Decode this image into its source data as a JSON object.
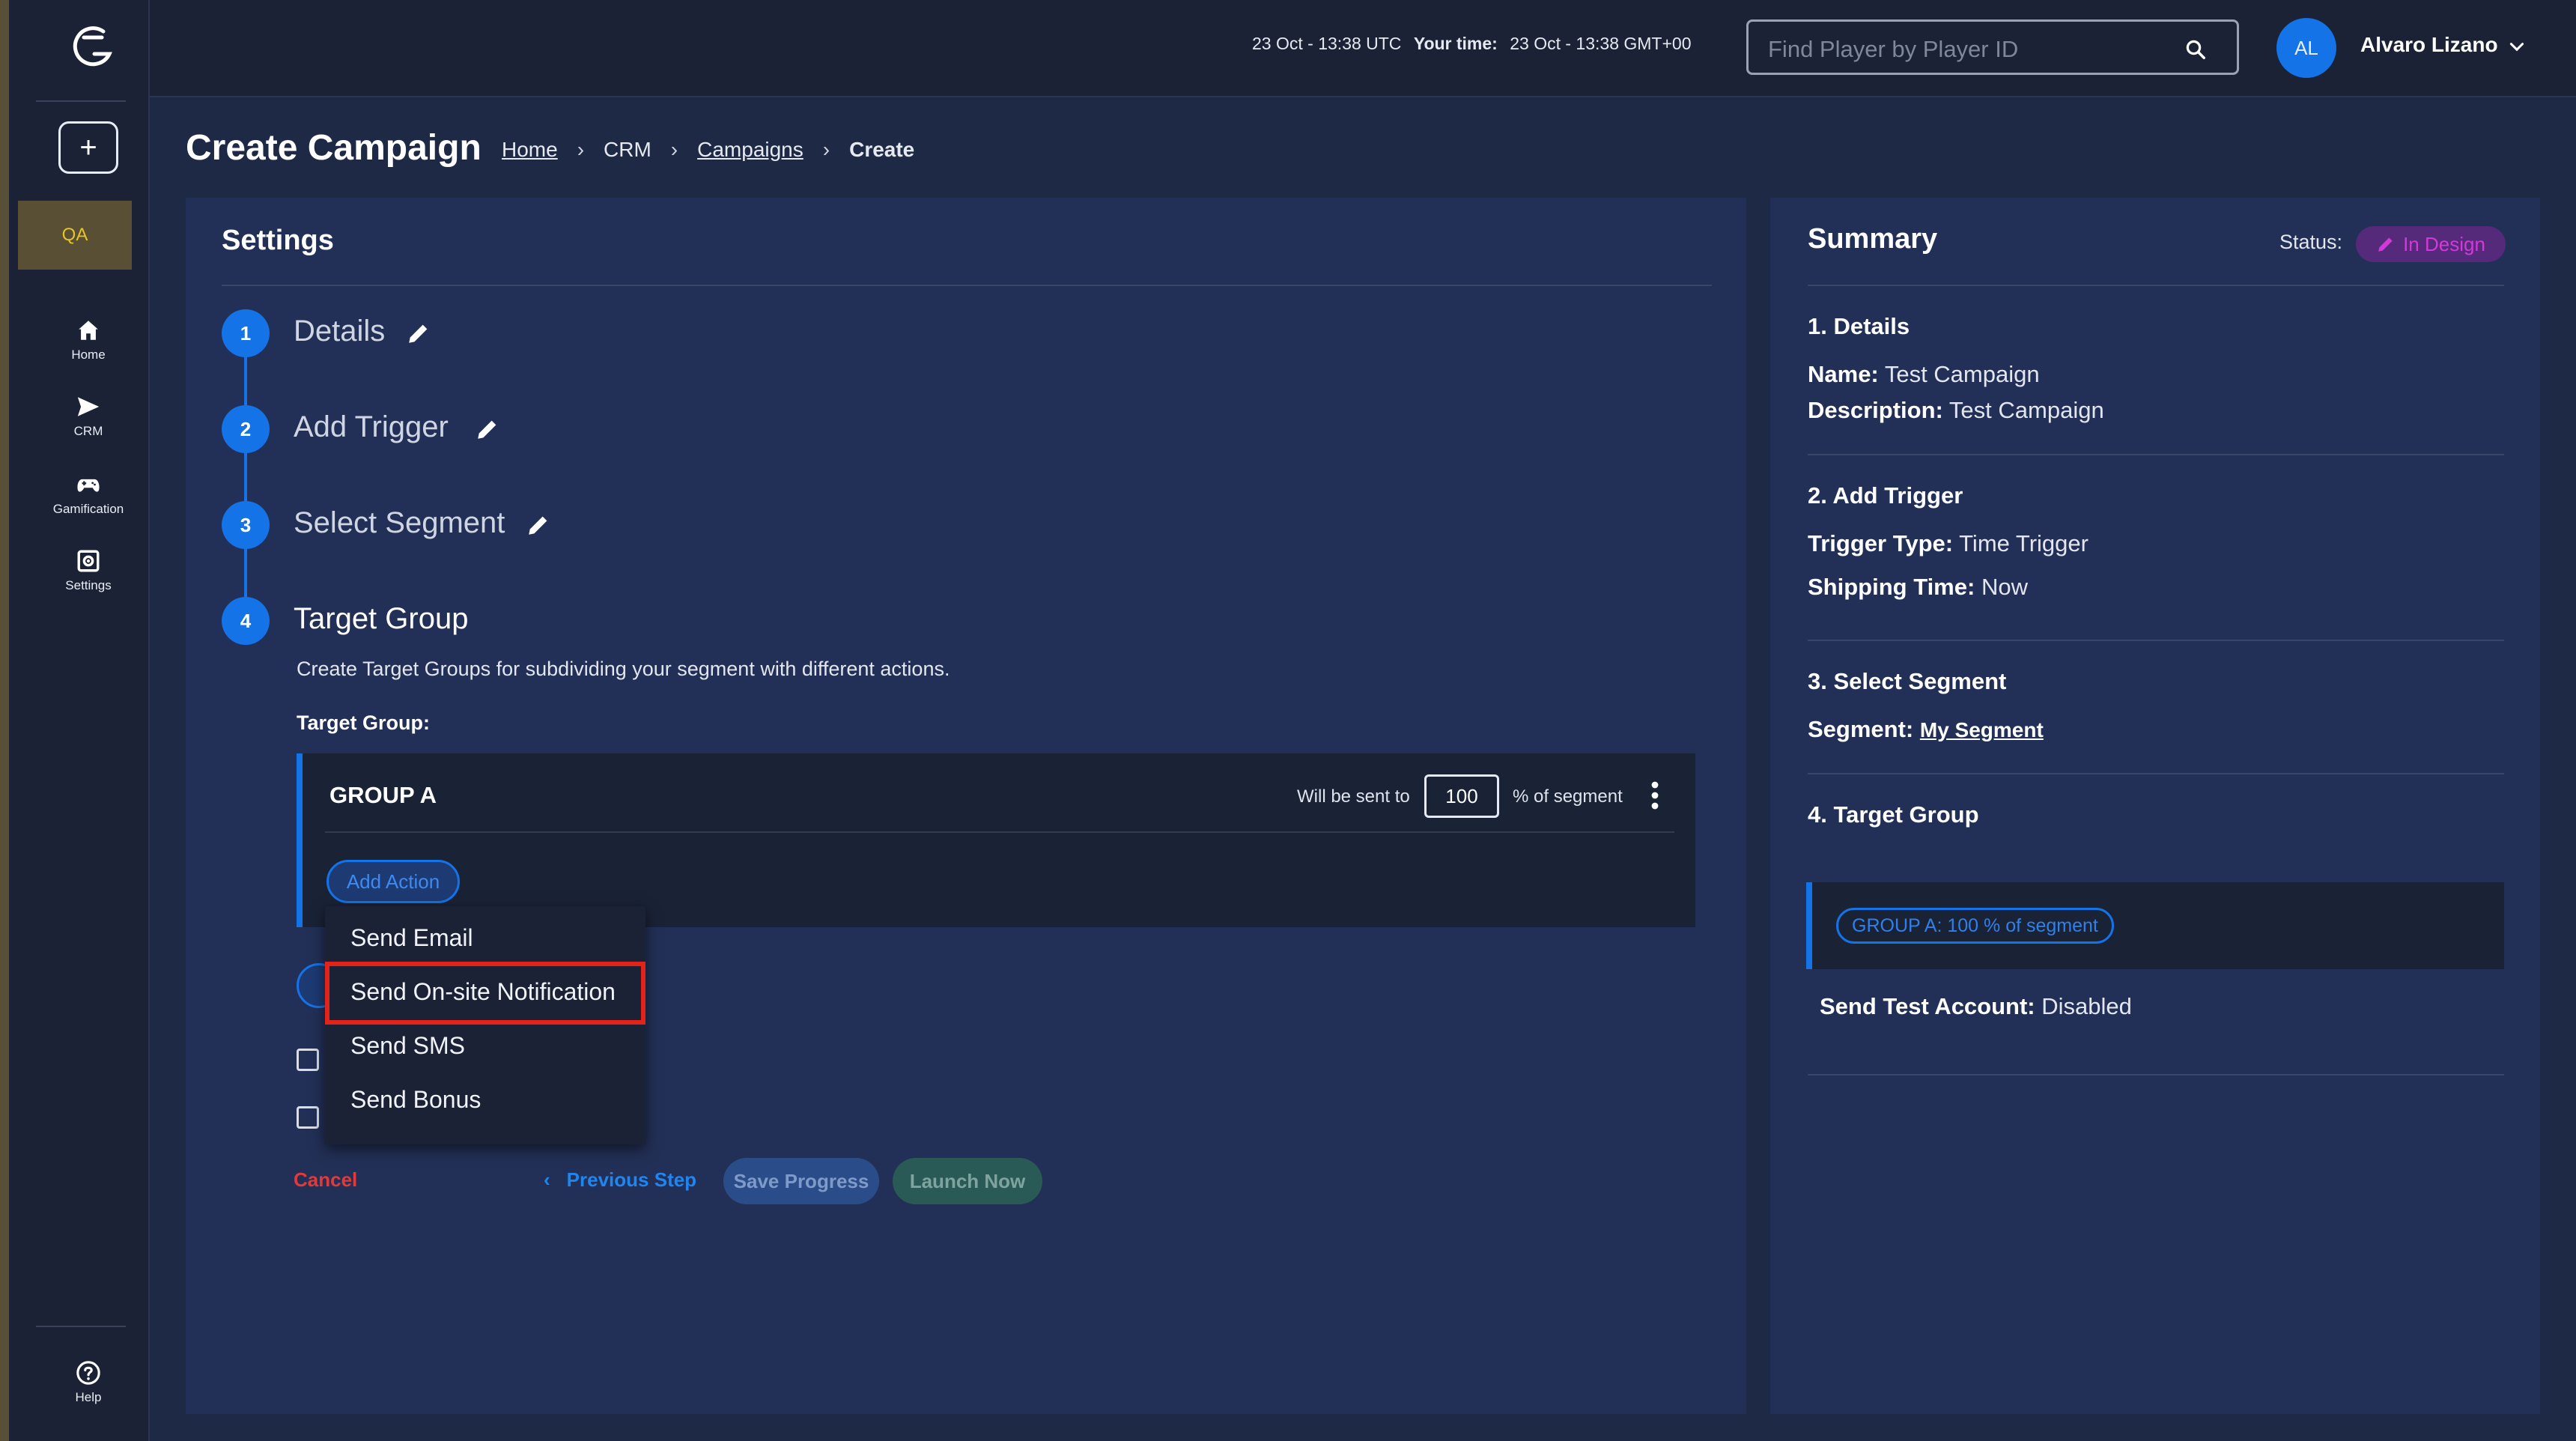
{
  "app": {
    "qa_label": "QA",
    "nav": [
      {
        "label": "Home",
        "icon": "home-icon"
      },
      {
        "label": "CRM",
        "icon": "send-icon"
      },
      {
        "label": "Gamification",
        "icon": "gamepad-icon"
      },
      {
        "label": "Settings",
        "icon": "settings-icon"
      }
    ],
    "help_label": "Help"
  },
  "topbar": {
    "server_time": "23 Oct - 13:38 UTC",
    "your_time_label": "Your time:",
    "your_time": "23 Oct - 13:38 GMT+00",
    "search_placeholder": "Find Player by Player ID",
    "user_initials": "AL",
    "user_name": "Alvaro Lizano"
  },
  "page": {
    "title": "Create Campaign",
    "breadcrumbs": [
      "Home",
      "CRM",
      "Campaigns",
      "Create"
    ]
  },
  "settings": {
    "title": "Settings",
    "steps": [
      {
        "number": "1",
        "label": "Details"
      },
      {
        "number": "2",
        "label": "Add Trigger"
      },
      {
        "number": "3",
        "label": "Select Segment"
      },
      {
        "number": "4",
        "label": "Target Group"
      }
    ],
    "target_group_description": "Create Target Groups for subdividing your segment with different actions.",
    "target_group_label": "Target Group:",
    "group": {
      "name": "GROUP A",
      "sent_prefix": "Will be sent to",
      "percent": "100",
      "sent_suffix": "% of segment",
      "add_action_label": "Add Action"
    },
    "action_menu": [
      "Send Email",
      "Send On-site Notification",
      "Send SMS",
      "Send Bonus"
    ],
    "highlighted_action": "Send On-site Notification",
    "footer": {
      "cancel": "Cancel",
      "previous": "Previous Step",
      "save": "Save Progress",
      "launch": "Launch Now"
    }
  },
  "summary": {
    "title": "Summary",
    "status_label": "Status:",
    "status_value": "In Design",
    "details_heading": "1. Details",
    "name_label": "Name:",
    "name_value": "Test Campaign",
    "description_label": "Description:",
    "description_value": "Test Campaign",
    "trigger_heading": "2. Add Trigger",
    "trigger_type_label": "Trigger Type:",
    "trigger_type_value": "Time Trigger",
    "shipping_label": "Shipping Time:",
    "shipping_value": "Now",
    "segment_heading": "3. Select Segment",
    "segment_label": "Segment:",
    "segment_value": "My Segment",
    "target_heading": "4. Target Group",
    "group_badge": "GROUP A: 100 % of segment",
    "test_account_label": "Send Test Account:",
    "test_account_value": "Disabled"
  },
  "colors": {
    "accent": "#1473e6",
    "danger": "#e23a3a",
    "status": "#d13ad8",
    "qa": "#e7c32a"
  }
}
